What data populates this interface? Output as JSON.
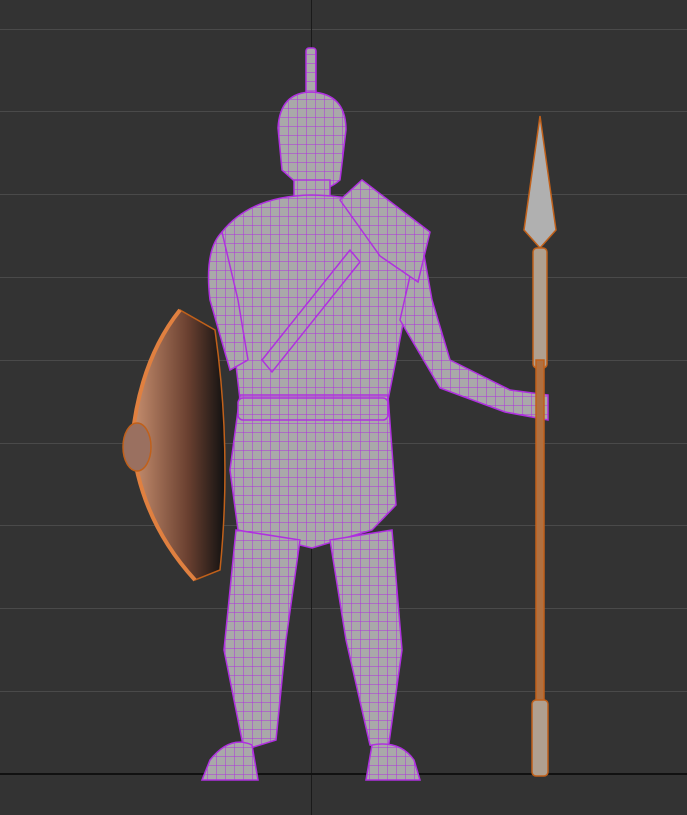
{
  "viewport": {
    "background_color": "#333333",
    "grid_color": "#4a4a4a",
    "axis_color": "#111111"
  },
  "model": {
    "character_wire_color": "#b030e0",
    "shield_wire_color": "#c0601a",
    "spear_wire_color": "#c0601a",
    "surface_color": "#a8a8a8"
  }
}
